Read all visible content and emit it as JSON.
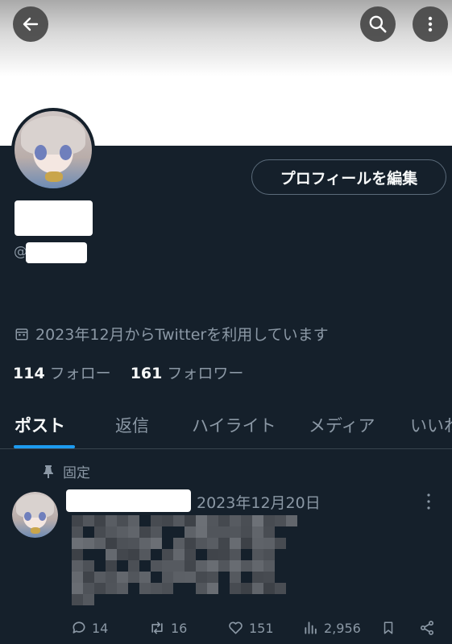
{
  "profile": {
    "edit_button": "プロフィールを編集",
    "handle_prefix": "@",
    "joined": "2023年12月からTwitterを利用しています"
  },
  "stats": {
    "following_count": "114",
    "following_label": "フォロー",
    "followers_count": "161",
    "followers_label": "フォロワー"
  },
  "tabs": [
    {
      "label": "ポスト",
      "active": true
    },
    {
      "label": "返信"
    },
    {
      "label": "ハイライト"
    },
    {
      "label": "メディア"
    },
    {
      "label": "いいね"
    }
  ],
  "pinned_post": {
    "pinned_label": "固定",
    "date": "2023年12月20日",
    "replies": "14",
    "reposts": "16",
    "likes": "151",
    "views": "2,956"
  },
  "colors": {
    "background": "#15202b",
    "accent": "#1d9bf0",
    "muted_text": "#8b98a5"
  }
}
